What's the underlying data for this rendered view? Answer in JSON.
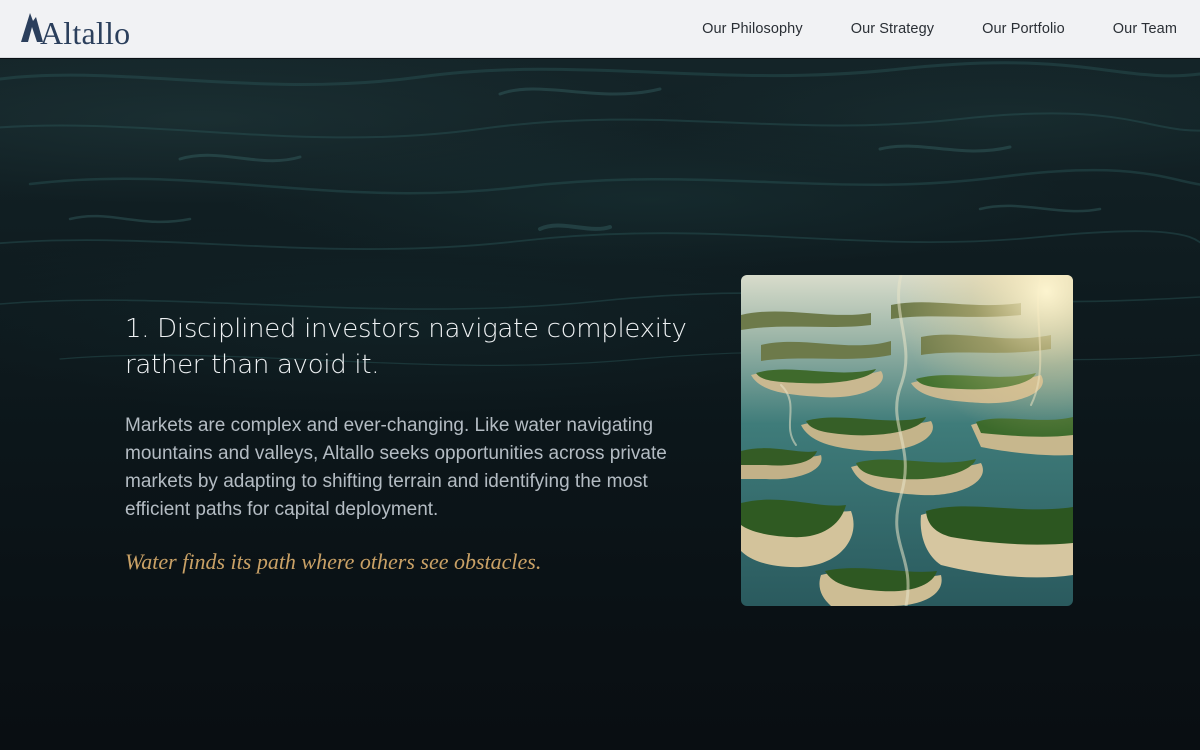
{
  "header": {
    "logo_text": "Altallo",
    "nav": [
      {
        "label": "Our Philosophy"
      },
      {
        "label": "Our Strategy"
      },
      {
        "label": "Our Portfolio"
      },
      {
        "label": "Our Team"
      }
    ]
  },
  "hero": {
    "heading": "1. Disciplined investors navigate complexity rather than avoid it.",
    "body": "Markets are complex and ever-changing. Like water navigating mountains and valleys, Altallo seeks opportunities across private markets by adapting to shifting terrain and identifying the most efficient paths for capital deployment.",
    "tagline": "Water finds its path where others see obstacles."
  },
  "colors": {
    "header_bg": "#f1f2f4",
    "logo": "#2b3f5c",
    "hero_bg": "#0c161a",
    "heading": "#eef1f3",
    "body": "#b4bcc3",
    "accent": "#c9a166"
  }
}
